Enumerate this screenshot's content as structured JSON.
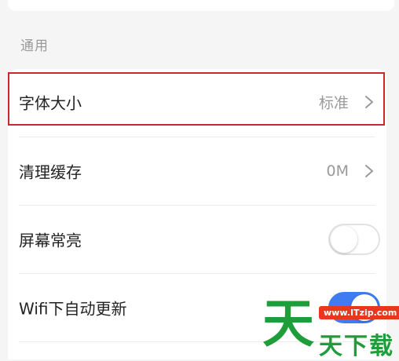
{
  "section": {
    "title": "通用"
  },
  "settings": [
    {
      "label": "字体大小",
      "value": "标准",
      "has_chevron": true
    },
    {
      "label": "清理缓存",
      "value": "0M",
      "has_chevron": true
    },
    {
      "label": "屏幕常亮",
      "toggle": "off"
    },
    {
      "label": "Wifi下自动更新",
      "toggle": "on"
    }
  ],
  "colors": {
    "highlight_border": "#c9282d",
    "toggle_on": "#3f7cf2",
    "watermark_green": "#1e9e3a",
    "watermark_red": "#e8361f"
  },
  "watermark": {
    "big_char": "天",
    "url": "www.ITzip.com",
    "text": "天下载"
  },
  "icons": {
    "chevron": "chevron-right-icon"
  }
}
